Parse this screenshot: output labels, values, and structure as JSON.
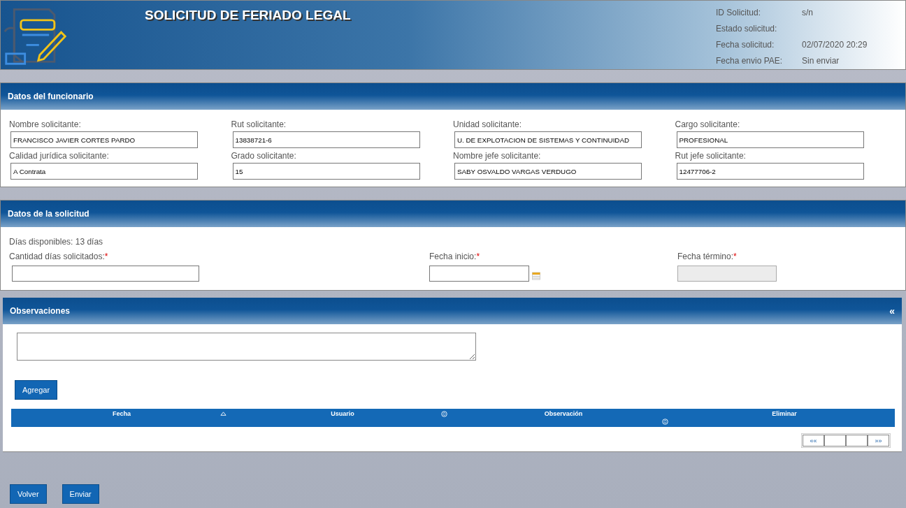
{
  "header": {
    "title": "SOLICITUD DE FERIADO LEGAL",
    "info": [
      {
        "label": "ID Solicitud:",
        "value": "s/n"
      },
      {
        "label": "Estado solicitud:"
      },
      {
        "label": "Fecha solicitud:",
        "value": "02/07/2020 20:29"
      },
      {
        "label": "Fecha envio PAE:",
        "value": "Sin enviar"
      }
    ]
  },
  "funcionario": {
    "title": "Datos del funcionario",
    "fields": [
      {
        "label": "Nombre solicitante:",
        "value": "FRANCISCO JAVIER CORTES PARDO"
      },
      {
        "label": "Rut solicitante:",
        "value": "13838721-6"
      },
      {
        "label": "Unidad solicitante:",
        "value": "U. DE EXPLOTACION DE SISTEMAS Y CONTINUIDAD"
      },
      {
        "label": "Cargo solicitante:",
        "value": "PROFESIONAL"
      },
      {
        "label": "Calidad jurídica solicitante:",
        "value": "A Contrata"
      },
      {
        "label": "Grado solicitante:",
        "value": "15"
      },
      {
        "label": "Nombre jefe solicitante:",
        "value": "SABY OSVALDO VARGAS VERDUGO"
      },
      {
        "label": "Rut jefe solicitante:",
        "value": "12477706-2"
      }
    ]
  },
  "solicitud": {
    "title": "Datos de la solicitud",
    "available": "Días disponibles: 13 días",
    "fields": [
      {
        "label": "Cantidad días solicitados:",
        "required_mark": "*",
        "disabled": false,
        "calendar": false
      },
      {
        "label": "Fecha inicio:",
        "required_mark": "*",
        "disabled": false,
        "calendar": true
      },
      {
        "label": "Fecha término:",
        "required_mark": "*",
        "disabled": true,
        "calendar": false
      }
    ]
  },
  "observaciones": {
    "title": "Observaciones",
    "collapse": "«",
    "add_button": "Agregar",
    "columns": [
      {
        "label": "Fecha",
        "sorted_asc": true
      },
      {
        "label": "Usuario",
        "sorted_asc": false
      },
      {
        "label": "Observación",
        "sorted_asc": false
      },
      {
        "label": "Eliminar"
      }
    ],
    "pager": {
      "first": "««",
      "last": "»»"
    }
  },
  "buttons": [
    "Volver",
    "Enviar"
  ]
}
